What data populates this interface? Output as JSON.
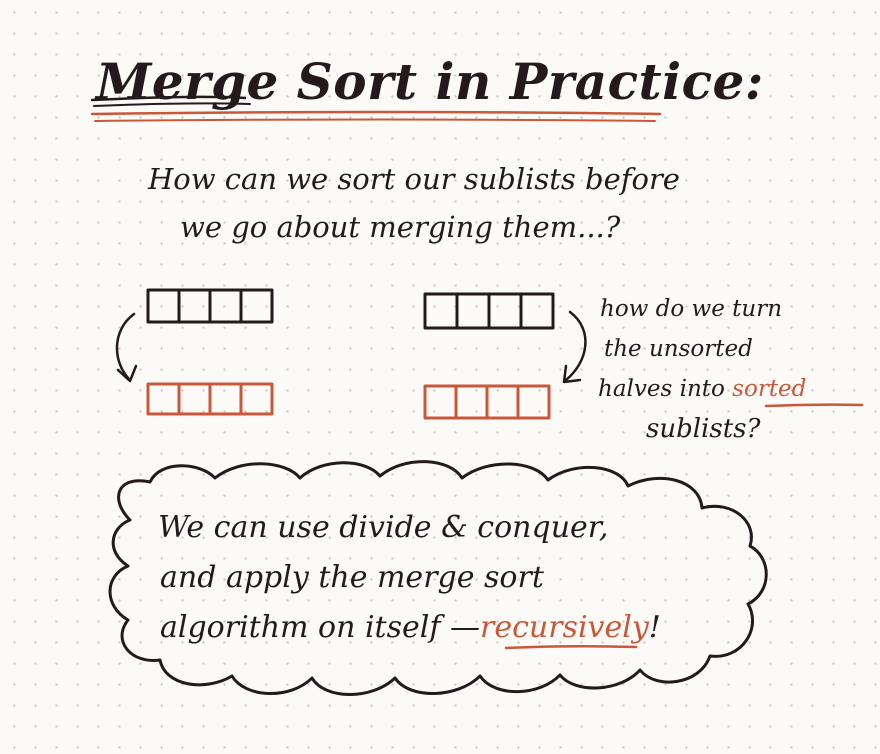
{
  "title": "Merge Sort in Practice:",
  "question": {
    "line1": "How can we sort our sublists before",
    "line2": "we go about merging them...?"
  },
  "note": {
    "line1": "how do we turn",
    "line2": "the unsorted",
    "line3_prefix": "halves into",
    "line3_highlight": "sorted",
    "line4": "sublists?"
  },
  "cloud": {
    "line1": "We can use divide & conquer,",
    "line2": "and apply the merge sort",
    "line3_prefix": "algorithm on itself —",
    "line3_highlight": "recursively",
    "line3_suffix": "!"
  },
  "colors": {
    "ink": "#241a1d",
    "accent": "#c9583a",
    "paper": "#fbfaf7"
  }
}
